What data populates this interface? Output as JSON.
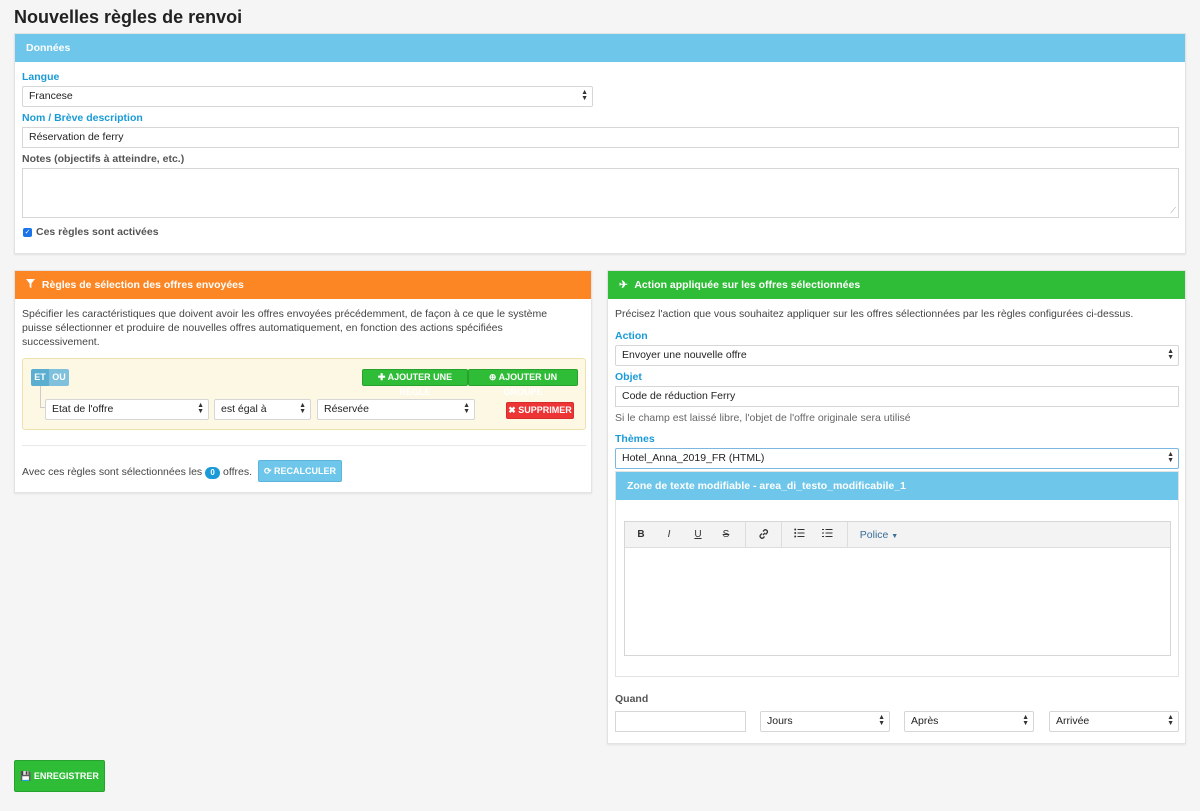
{
  "page_title": "Nouvelles règles de renvoi",
  "data_panel": {
    "title": "Données",
    "language_label": "Langue",
    "language_value": "Francese",
    "name_label": "Nom / Brève description",
    "name_value": "Réservation de ferry",
    "notes_label": "Notes (objectifs à atteindre, etc.)",
    "notes_value": "",
    "active_label": "Ces règles sont activées",
    "active_checked": true
  },
  "rules_panel": {
    "title": "Règles de sélection des offres envoyées",
    "description": "Spécifier les caractéristiques que doivent avoir les offres envoyées précédemment, de façon à ce que le système puisse sélectionner et produire de nouvelles offres automatiquement, en fonction des actions spécifiées successivement.",
    "and_label": "ET",
    "or_label": "OU",
    "add_rule_label": "AJOUTER UNE RÈGLE",
    "add_group_label": "AJOUTER UN GROUPE",
    "rule_field": "Etat de l'offre",
    "rule_operator": "est égal à",
    "rule_value": "Réservée",
    "delete_label": "SUPPRIMER",
    "selected_prefix": "Avec ces règles sont sélectionnées les",
    "selected_count": "0",
    "selected_suffix": "offres.",
    "recalc_label": "RECALCULER"
  },
  "action_panel": {
    "title": "Action appliquée sur les offres sélectionnées",
    "description": "Précisez l'action que vous souhaitez appliquer sur les offres sélectionnées par les règles configurées ci-dessus.",
    "action_label": "Action",
    "action_value": "Envoyer une nouvelle offre",
    "subject_label": "Objet",
    "subject_value": "Code de réduction Ferry",
    "subject_help": "Si le champ est laissé libre, l'objet de l'offre originale sera utilisé",
    "themes_label": "Thèmes",
    "themes_value": "Hotel_Anna_2019_FR (HTML)",
    "editable_zone_title": "Zone de texte modifiable - area_di_testo_modificabile_1",
    "toolbar": {
      "bold": "B",
      "italic": "I",
      "underline": "U",
      "strike": "S",
      "font": "Police"
    },
    "when_label": "Quand",
    "when_value": "",
    "unit_value": "Jours",
    "relation_value": "Après",
    "reference_value": "Arrivée"
  },
  "save_label": "ENREGISTRER",
  "colors": {
    "blue_header": "#6ec6ea",
    "orange_header": "#fb8623",
    "green_header": "#2fbc36",
    "label_blue": "#1a9bd7",
    "danger": "#ee3535"
  }
}
